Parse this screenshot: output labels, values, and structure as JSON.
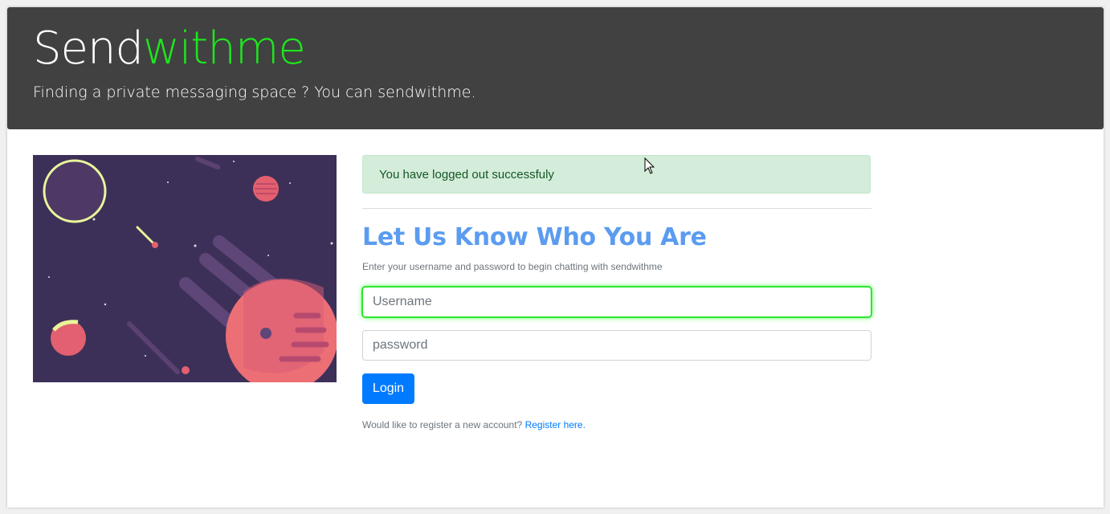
{
  "header": {
    "brand_prefix": "Send",
    "brand_accent": "withme",
    "tagline": "Finding a private messaging space ? You can sendwithme."
  },
  "hero": {
    "image": "space-planets-illustration"
  },
  "alert": {
    "message": "You have logged out successfuly"
  },
  "form": {
    "heading": "Let Us Know Who You Are",
    "subtext": "Enter your username and password to begin chatting with sendwithme",
    "username_placeholder": "Username",
    "password_placeholder": "password",
    "login_label": "Login",
    "register_prompt": "Would like to register a new account?",
    "register_link": "Register here."
  },
  "colors": {
    "header_bg": "#414141",
    "brand_accent": "#1ee61e",
    "heading": "#5b9cf0",
    "primary": "#007bff",
    "alert_bg": "#d4edda",
    "focus_glow": "#2fe62f"
  }
}
